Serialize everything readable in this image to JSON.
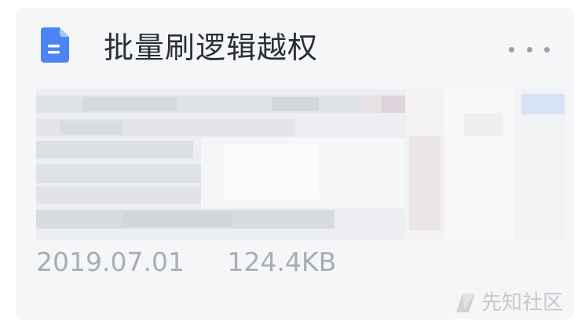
{
  "file": {
    "title": "批量刷逻辑越权",
    "date": "2019.07.01",
    "size": "124.4KB",
    "icon": "document-icon"
  },
  "menu": {
    "icon": "more-icon"
  },
  "watermark": {
    "text": "先知社区",
    "icon": "xianzhi-logo"
  },
  "colors": {
    "icon_blue": "#4c84f3",
    "card_bg": "#f5f6f8",
    "title": "#2b2f36",
    "meta": "#a8adb4"
  }
}
